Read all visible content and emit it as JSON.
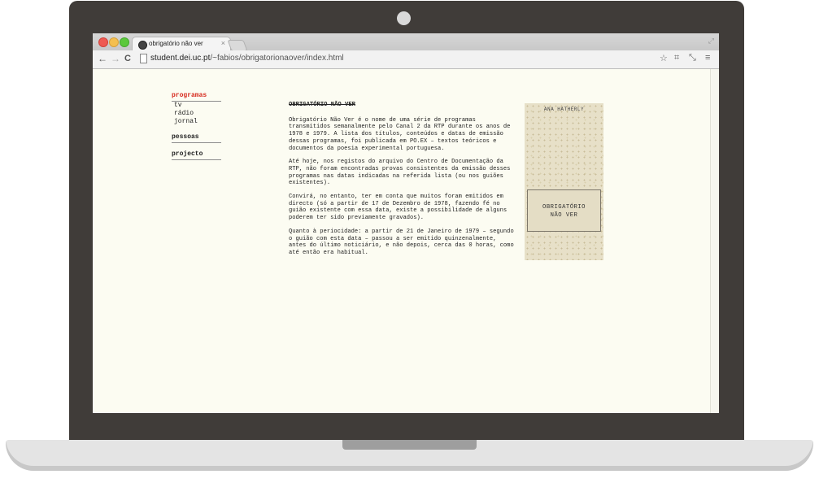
{
  "browser": {
    "tab_title": "obrigatório não ver",
    "tab_close": "×",
    "url_host": "student.dei.uc.pt",
    "url_path": "/~fabios/obrigatorionaover/index.html"
  },
  "nav": {
    "sections": {
      "programas": "programas",
      "tv": "tv",
      "radio": "rádio",
      "jornal": "jornal",
      "pessoas": "pessoas",
      "projecto": "projecto"
    }
  },
  "article": {
    "title": "OBRIGATÓRIO NÃO VER",
    "p1": "Obrigatório Não Ver é o nome de uma série de programas transmitidos semanalmente pelo Canal 2 da RTP durante os anos de 1978 e 1979. A lista dos títulos, conteúdos e datas de emissão dessas programas, foi publicada em PO.EX – textos teóricos e documentos da poesia experimental portuguesa.",
    "p2": "Até hoje, nos registos do arquivo do Centro de Documentação da RTP, não foram encontradas provas consistentes da emissão desses programas nas datas indicadas na referida lista (ou nos guiões existentes).",
    "p3": "Convirá, no entanto, ter em conta que muitos foram emitidos em directo (só a partir de 17 de Dezembro de 1978, fazendo fé no guião existente com essa data, existe a possibilidade de alguns poderem ter sido previamente gravados).",
    "p4": "Quanto à periocidade: a partir de 21 de Janeiro de 1979 – segundo o guião com esta data – passou a ser emitido quinzenalmente, antes do último noticiário, e não depois, cerca das 0 horas, como até então era habitual."
  },
  "cover": {
    "author": "ANA HATHERLY",
    "title_line1": "OBRIGATÓRIO",
    "title_line2": "NÃO VER"
  },
  "colors": {
    "nav_active": "#d62a1e",
    "page_bg": "#fcfcf2",
    "bezel": "#403c39"
  }
}
